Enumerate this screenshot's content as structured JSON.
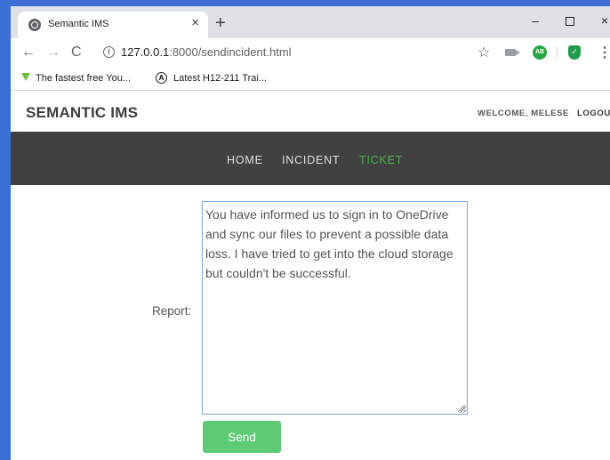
{
  "browser": {
    "tab_title": "Semantic IMS",
    "tab_close": "×",
    "new_tab": "+",
    "window_controls": {
      "minimize": "–",
      "close": "×"
    },
    "url_host": "127.0.0.1",
    "url_rest": ":8000/sendincident.html",
    "bookmarks": [
      {
        "label": "The fastest free You...",
        "icon": "download-arrow-icon"
      },
      {
        "label": "Latest H12-211 Trai...",
        "icon": "circle-a-icon"
      }
    ],
    "extensions": {
      "ab_label": "AB"
    }
  },
  "app": {
    "brand": "SEMANTIC IMS",
    "welcome": "WELCOME, MELESE",
    "logout": "LOGOU",
    "nav": [
      {
        "label": "HOME"
      },
      {
        "label": "INCIDENT"
      },
      {
        "label": "TICKET",
        "active": true
      }
    ],
    "accent_color": "#4caf50",
    "navbar_color": "#414141"
  },
  "form": {
    "report_label": "Report:",
    "report_value": "You have informed us to sign in to OneDrive and sync our files to prevent a possible data loss. I have tried to get into the cloud storage but couldn't be successful.",
    "send_label": "Send"
  }
}
